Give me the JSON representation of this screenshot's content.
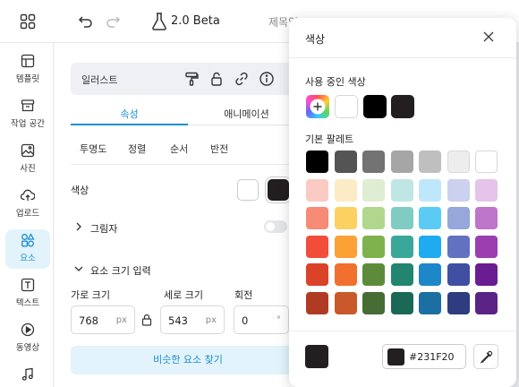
{
  "topbar": {
    "version": "2.0 Beta",
    "doc_title": "제목없"
  },
  "nav": [
    {
      "label": "템플릿",
      "icon": "template-icon"
    },
    {
      "label": "작업 공간",
      "icon": "workspace-icon"
    },
    {
      "label": "사진",
      "icon": "photo-icon"
    },
    {
      "label": "업로드",
      "icon": "upload-icon"
    },
    {
      "label": "요소",
      "icon": "elements-icon",
      "active": true
    },
    {
      "label": "텍스트",
      "icon": "text-icon"
    },
    {
      "label": "동영상",
      "icon": "video-icon"
    }
  ],
  "panel": {
    "element_name": "일러스트",
    "tabs": [
      "속성",
      "애니메이션"
    ],
    "subtabs": [
      "투명도",
      "정렬",
      "순서",
      "반전"
    ],
    "color_label": "색상",
    "shadow_label": "그림자",
    "size_label": "요소 크기 입력",
    "width_label": "가로 크기",
    "height_label": "세로 크기",
    "rotation_label": "회전",
    "width_value": "768",
    "height_value": "543",
    "rotation_value": "0",
    "unit_px": "px",
    "unit_deg": "°",
    "similar_button": "비슷한 요소 찾기"
  },
  "popup": {
    "title": "색상",
    "used_title": "사용 중인 색상",
    "palette_title": "기본 팔레트",
    "hex_value": "#231F20",
    "used_colors": [
      "#FFFFFF",
      "#000000",
      "#231F20"
    ],
    "palette": [
      [
        "#000000",
        "#545454",
        "#737373",
        "#A6A6A6",
        "#BFBFBF",
        "#EDEDED",
        "#FFFFFF"
      ],
      [
        "#F9CBC3",
        "#FCEBC5",
        "#DFEDD3",
        "#BFE6E4",
        "#BFE7FB",
        "#CBD1EE",
        "#E4C4E8"
      ],
      [
        "#F68B76",
        "#FDD161",
        "#B1D78E",
        "#80CCC3",
        "#5BCBF5",
        "#96A8DA",
        "#BD76C9"
      ],
      [
        "#F14D3A",
        "#FBA135",
        "#7FB24D",
        "#3AA79B",
        "#1FABEF",
        "#6272C0",
        "#9A3EB0"
      ],
      [
        "#DA4229",
        "#F2702F",
        "#5C8C3A",
        "#218570",
        "#1D87C9",
        "#404FA2",
        "#6A1D92"
      ],
      [
        "#B03B25",
        "#C9582B",
        "#476C34",
        "#1A6855",
        "#1C6FA3",
        "#2E3D7F",
        "#5A2385"
      ]
    ]
  }
}
